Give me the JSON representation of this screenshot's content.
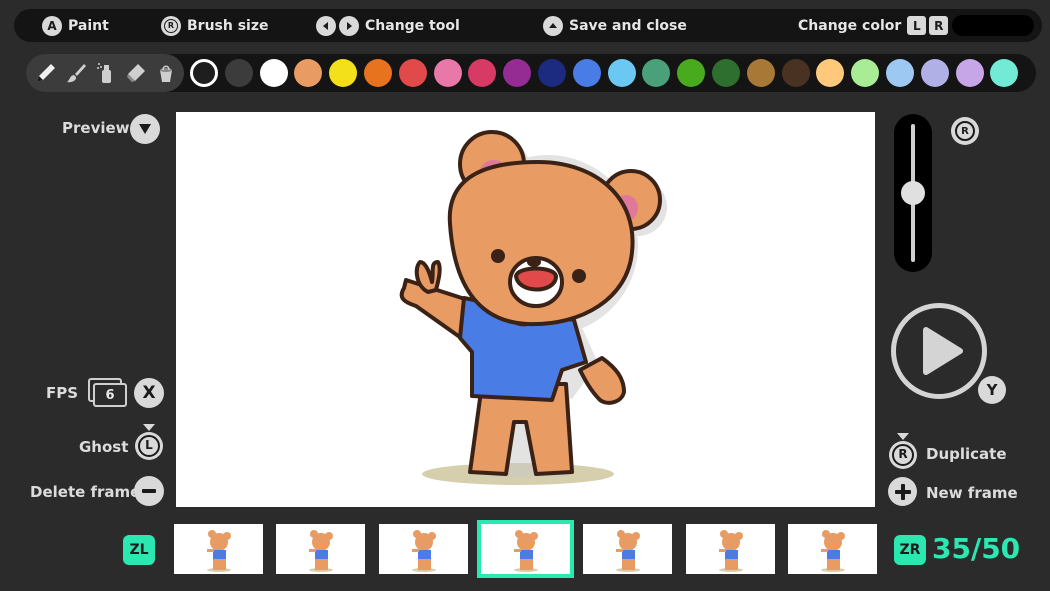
{
  "topbar": {
    "paint": {
      "button": "A",
      "label": "Paint"
    },
    "brush_size": {
      "button": "R",
      "label": "Brush size"
    },
    "change_tool": {
      "label": "Change tool"
    },
    "save_close": {
      "label": "Save and close"
    },
    "change_color": {
      "label": "Change color",
      "left": "L",
      "right": "R"
    }
  },
  "tools": [
    "pencil-icon",
    "brush-icon",
    "spray-icon",
    "eraser-icon",
    "bucket-icon"
  ],
  "palette": {
    "selected_index": 0,
    "colors": [
      "#1e1e1e",
      "#3c3c3c",
      "#ffffff",
      "#e89b63",
      "#f4e01a",
      "#e8731e",
      "#e04a4a",
      "#e878a8",
      "#d83a66",
      "#942c94",
      "#1c2a80",
      "#4a7ce6",
      "#6ac8f2",
      "#4aa078",
      "#4aaa1e",
      "#2e6e2e",
      "#a87836",
      "#4a3222",
      "#ffc87a",
      "#a8ec96",
      "#9cc8f2",
      "#b0b0e6",
      "#c6a6e6",
      "#72ead6"
    ]
  },
  "left_panel": {
    "preview": {
      "label": "Preview"
    },
    "fps": {
      "label": "FPS",
      "value": "6",
      "button": "X"
    },
    "ghost": {
      "label": "Ghost",
      "button": "L"
    },
    "delete": {
      "label": "Delete frame"
    }
  },
  "right_panel": {
    "size_button": "R",
    "brush_size_level": 0.5,
    "play_button": "Y",
    "duplicate": {
      "label": "Duplicate",
      "button": "R"
    },
    "new_frame": {
      "label": "New frame"
    }
  },
  "timeline": {
    "left_button": "ZL",
    "right_button": "ZR",
    "thumbnails": 7,
    "current_thumbnail": 3,
    "counter": "35/50"
  }
}
